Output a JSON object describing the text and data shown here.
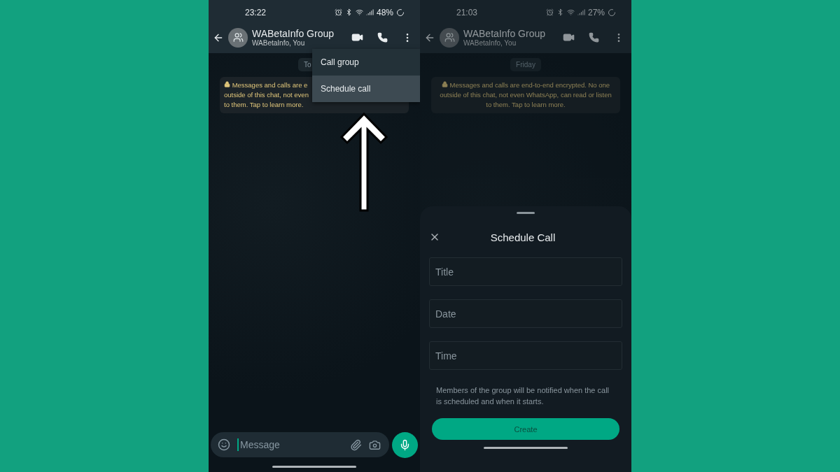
{
  "screens": [
    {
      "status_bar": {
        "time": "23:22",
        "battery": "48%"
      },
      "header": {
        "title": "WABetaInfo Group",
        "subtitle": "WABetaInfo, You"
      },
      "dimmed": false,
      "date_chip": "To",
      "notice": [
        "Messages and calls are e",
        "outside of this chat, not even",
        "to them. Tap to learn more."
      ],
      "menu": {
        "items": [
          {
            "label": "Call group",
            "selected": false
          },
          {
            "label": "Schedule call",
            "selected": true
          }
        ]
      },
      "composer": {
        "placeholder": "Message"
      }
    },
    {
      "status_bar": {
        "time": "21:03",
        "battery": "27%"
      },
      "header": {
        "title": "WABetaInfo Group",
        "subtitle": "WABetaInfo, You"
      },
      "dimmed": true,
      "date_chip": "Friday",
      "notice": [
        "Messages and calls are end-to-end encrypted. No one",
        "outside of this chat, not even WhatsApp, can read or listen",
        "to them. Tap to learn more."
      ],
      "sheet": {
        "title": "Schedule Call",
        "fields": [
          {
            "placeholder": "Title"
          },
          {
            "placeholder": "Date"
          },
          {
            "placeholder": "Time"
          }
        ],
        "note": "Members of the group will be notified when the call is scheduled and when it starts.",
        "button": {
          "label": "Create",
          "disabled": true
        }
      }
    }
  ]
}
